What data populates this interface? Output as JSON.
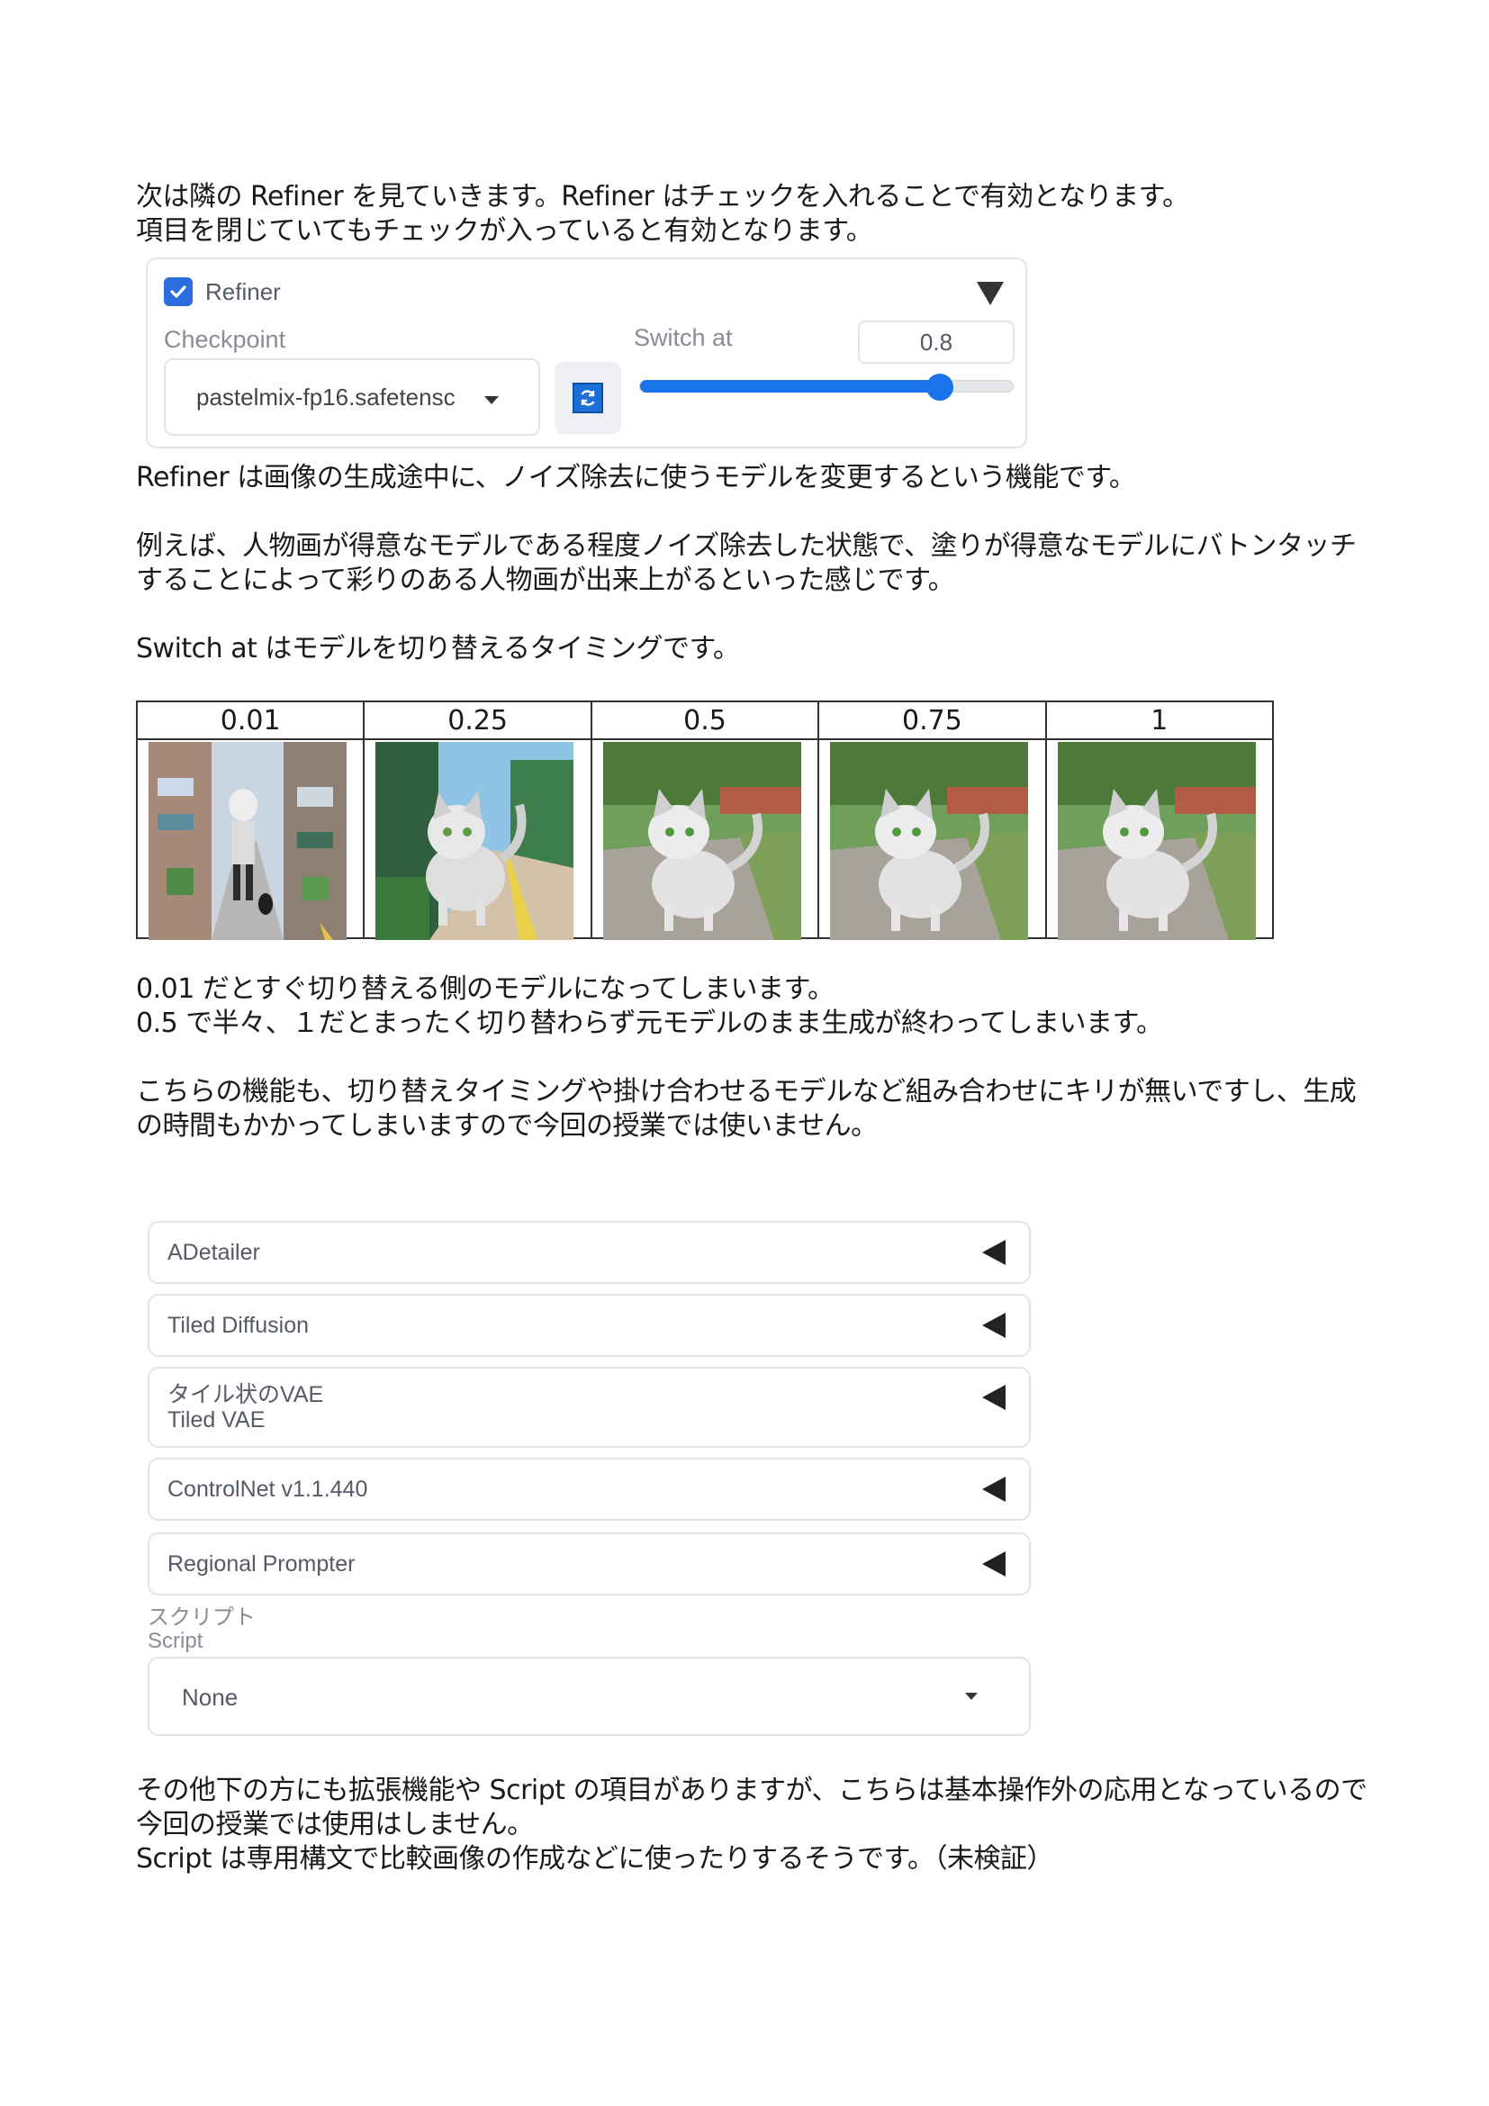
{
  "paragraphs": {
    "intro": [
      "次は隣の Refiner を見ていきます。Refiner はチェックを入れることで有効となります。",
      "項目を閉じていてもチェックが入っていると有効となります。"
    ],
    "explain": [
      "Refiner は画像の生成途中に、ノイズ除去に使うモデルを変更するという機能です。"
    ],
    "example": [
      "例えば、人物画が得意なモデルである程度ノイズ除去した状態で、塗りが得意なモデルにバトンタッチ",
      "することによって彩りのある人物画が出来上がるといった感じです。"
    ],
    "switch": [
      "Switch at はモデルを切り替えるタイミングです。"
    ],
    "result": [
      "0.01 だとすぐ切り替える側のモデルになってしまいます。",
      "0.5 で半々、１だとまったく切り替わらず元モデルのまま生成が終わってしまいます。"
    ],
    "note": [
      "こちらの機能も、切り替えタイミングや掛け合わせるモデルなど組み合わせにキリが無いですし、生成",
      "の時間もかかってしまいますので今回の授業では使いません。"
    ],
    "final": [
      "その他下の方にも拡張機能や Script の項目がありますが、こちらは基本操作外の応用となっているので",
      "今回の授業では使用はしません。",
      "Script は専用構文で比較画像の作成などに使ったりするそうです。（未検証）"
    ]
  },
  "refiner": {
    "enabled": true,
    "label": "Refiner",
    "checkpoint_label": "Checkpoint",
    "checkpoint_value": "pastelmix-fp16.safetensc",
    "switch_label": "Switch at",
    "switch_value": "0.8",
    "switch_fraction": 0.8
  },
  "comparison": {
    "headers": [
      "0.01",
      "0.25",
      "0.5",
      "0.75",
      "1"
    ]
  },
  "accordions": [
    {
      "label": "ADetailer"
    },
    {
      "label": "Tiled Diffusion"
    },
    {
      "label": "タイル状のVAE",
      "sub": "Tiled VAE"
    },
    {
      "label": "ControlNet v1.1.440"
    },
    {
      "label": "Regional Prompter"
    }
  ],
  "script": {
    "label_ja": "スクリプト",
    "label_en": "Script",
    "value": "None"
  },
  "colors": {
    "accent": "#1a73e8",
    "border": "#e4e4e7",
    "label": "#555a66"
  }
}
